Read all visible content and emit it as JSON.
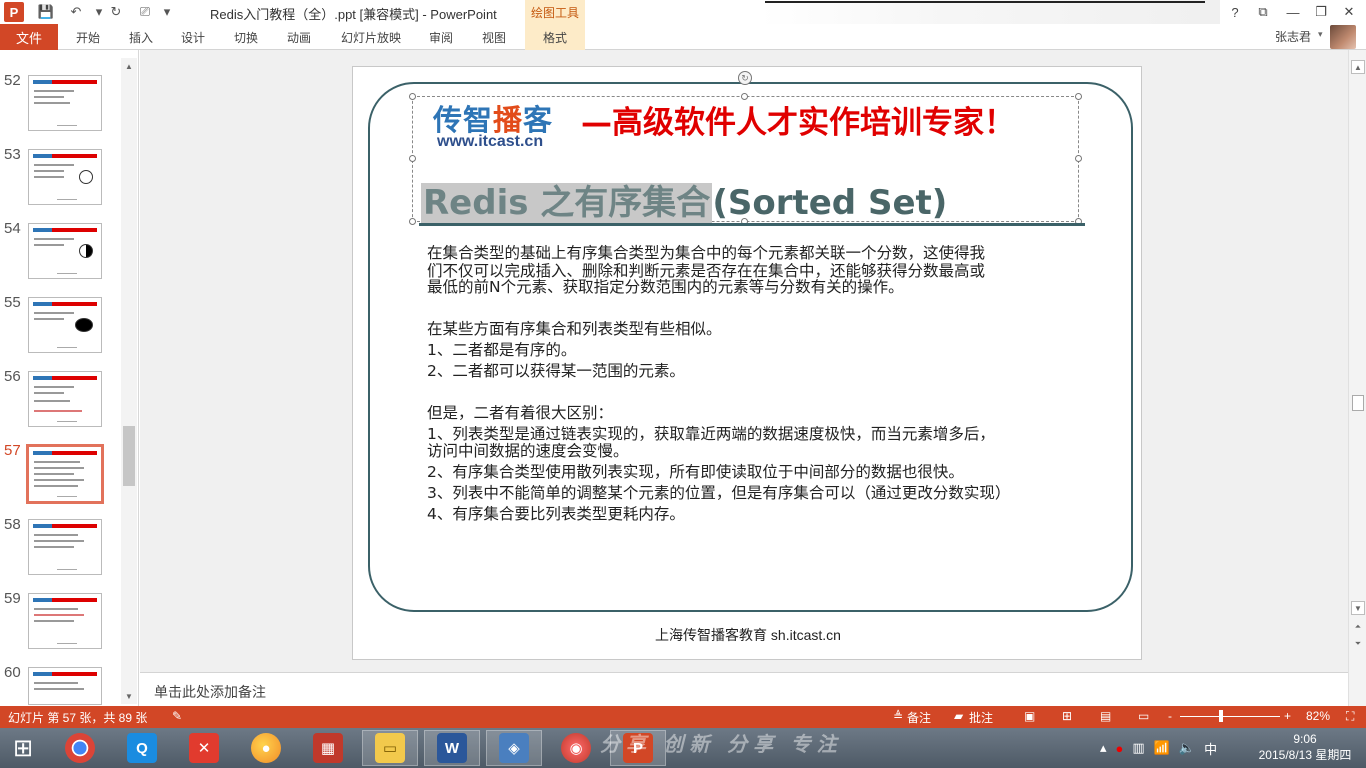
{
  "titlebar": {
    "app_icon": "P",
    "doc_title": "Redis入门教程（全）.ppt [兼容模式] - PowerPoint",
    "context_tab": "绘图工具",
    "icons": [
      "save-icon",
      "undo-icon",
      "redo-icon",
      "preview-icon"
    ]
  },
  "ribbon": {
    "file": "文件",
    "tabs": [
      "开始",
      "插入",
      "设计",
      "切换",
      "动画",
      "幻灯片放映",
      "审阅",
      "视图",
      "格式"
    ],
    "user": "张志君"
  },
  "thumbnails": {
    "numbers": [
      "52",
      "53",
      "54",
      "55",
      "56",
      "57",
      "58",
      "59",
      "60"
    ],
    "active": "57"
  },
  "slide": {
    "logo_cn": "传智",
    "logo_cn_hl": "播",
    "logo_cn_tail": "客",
    "logo_url": "www.itcast.cn",
    "slogan": "—高级软件人才实作培训专家！",
    "title_selected": "Redis 之有序集合",
    "title_rest": "(Sorted Set)",
    "body": [
      "在集合类型的基础上有序集合类型为集合中的每个元素都关联一个分数，这使得我",
      "们不仅可以完成插入、删除和判断元素是否存在在集合中，还能够获得分数最高或",
      "最低的前N个元素、获取指定分数范围内的元素等与分数有关的操作。",
      "在某些方面有序集合和列表类型有些相似。",
      "1、二者都是有序的。",
      "2、二者都可以获得某一范围的元素。",
      "但是，二者有着很大区别：",
      "1、列表类型是通过链表实现的，获取靠近两端的数据速度极快，而当元素增多后，",
      "访问中间数据的速度会变慢。",
      "2、有序集合类型使用散列表实现，所有即使读取位于中间部分的数据也很快。",
      "3、列表中不能简单的调整某个元素的位置，但是有序集合可以（通过更改分数实现）",
      "4、有序集合要比列表类型更耗内存。"
    ],
    "footer": "上海传智播客教育 sh.itcast.cn"
  },
  "notes": {
    "placeholder": "单击此处添加备注"
  },
  "statusbar": {
    "slide_info": "幻灯片 第 57 张，共 89 张",
    "notes_btn": "备注",
    "comments_btn": "批注",
    "zoom_minus": "-",
    "zoom_plus": "+",
    "zoom": "82%"
  },
  "taskbar": {
    "watermark": "分享 创新 分享 专注",
    "ime": "中",
    "time": "9:06",
    "date": "2015/8/13 星期四"
  },
  "colors": {
    "accent": "#d24726",
    "slide_frame": "#3b6168",
    "slogan_red": "#e00000",
    "logo_blue": "#2e75b6"
  }
}
